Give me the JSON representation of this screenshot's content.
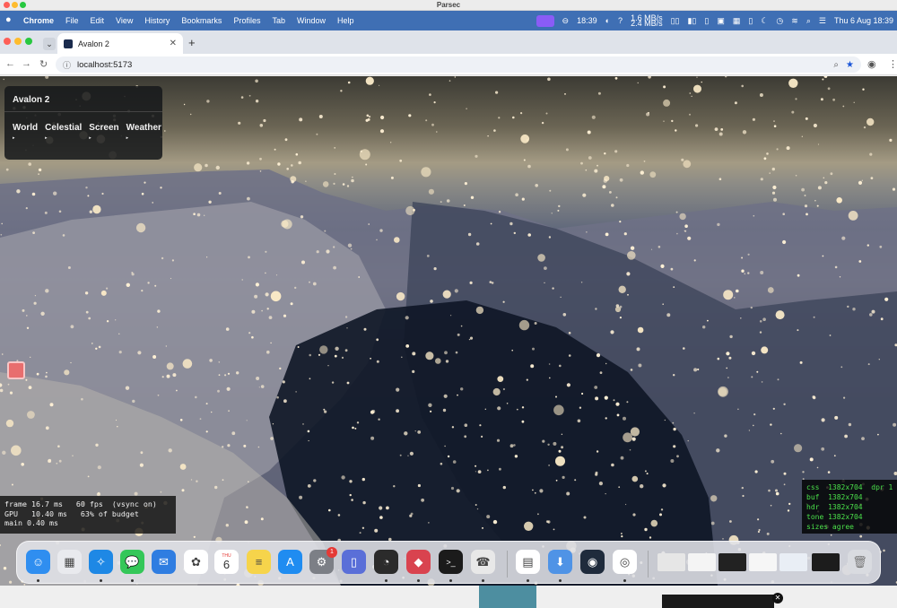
{
  "parsec": {
    "title": "Parsec"
  },
  "menubar": {
    "app": "Chrome",
    "items": [
      "File",
      "Edit",
      "View",
      "History",
      "Bookmarks",
      "Profiles",
      "Tab",
      "Window",
      "Help"
    ],
    "clock_left": "18:39",
    "net_up": "1.6 MB/s",
    "net_down": "2.4 MB/s",
    "datetime": "Thu 6 Aug  18:39"
  },
  "tab": {
    "title": "Avalon 2"
  },
  "address": {
    "url": "localhost:5173"
  },
  "panel": {
    "title": "Avalon 2",
    "tabs": [
      {
        "label": "World",
        "arrow": "▸"
      },
      {
        "label": "Celestial",
        "arrow": "▸"
      },
      {
        "label": "Screen",
        "arrow": "▸"
      },
      {
        "label": "Weather",
        "arrow": "▸"
      }
    ]
  },
  "perf": {
    "line1": "frame 16.7 ms   60 fps  (vsync on)",
    "line2": "GPU   10.40 ms   63% of budget",
    "line3": "main 0.40 ms"
  },
  "render_info": {
    "line1": "css  1382x704  dpr 1",
    "line2": "buf  1382x704",
    "line3": "hdr  1382x704",
    "line4": "tone 1382x704",
    "line5": "sizes agree"
  },
  "dock": {
    "calendar_month": "THU",
    "calendar_day": "6",
    "settings_badge": "1",
    "apps": [
      {
        "name": "finder-icon",
        "color": "#2f8ef0",
        "glyph": "☺"
      },
      {
        "name": "launchpad-icon",
        "color": "#e9eaee",
        "glyph": "▦"
      },
      {
        "name": "safari-icon",
        "color": "#1e88e5",
        "glyph": "✧"
      },
      {
        "name": "messages-icon",
        "color": "#34c759",
        "glyph": "💬"
      },
      {
        "name": "mail-icon",
        "color": "#2f7de1",
        "glyph": "✉"
      },
      {
        "name": "photos-icon",
        "color": "#ffffff",
        "glyph": "✿"
      },
      {
        "name": "calendar-icon",
        "color": "#ffffff",
        "glyph": ""
      },
      {
        "name": "notes-icon",
        "color": "#f6d44b",
        "glyph": "≡"
      },
      {
        "name": "app-store-icon",
        "color": "#1f8cf1",
        "glyph": "A"
      },
      {
        "name": "system-settings-icon",
        "color": "#7c7f86",
        "glyph": "⚙"
      },
      {
        "name": "simulator-icon",
        "color": "#5a6fd8",
        "glyph": "▯"
      },
      {
        "name": "speedometer-icon",
        "color": "#2b2b2b",
        "glyph": "◔"
      },
      {
        "name": "code-editor-icon",
        "color": "#d9434f",
        "glyph": "◆"
      },
      {
        "name": "terminal-icon",
        "color": "#1b1b1b",
        "glyph": ">_"
      },
      {
        "name": "phone-icon",
        "color": "#e8e8e8",
        "glyph": "☎"
      },
      {
        "name": "preview-icon",
        "color": "#ffffff",
        "glyph": "▤"
      },
      {
        "name": "updater-icon",
        "color": "#4f93e6",
        "glyph": "⬇"
      },
      {
        "name": "blender-icon",
        "color": "#1f2b3c",
        "glyph": "◉"
      },
      {
        "name": "chrome-icon",
        "color": "#ffffff",
        "glyph": "◎"
      }
    ]
  }
}
